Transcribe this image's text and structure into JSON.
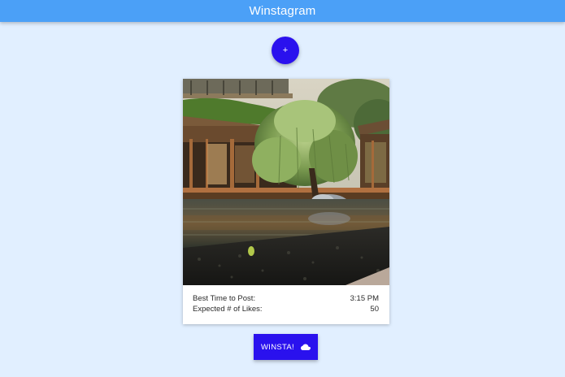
{
  "app": {
    "title": "Winstagram"
  },
  "add_button": {
    "label": "+"
  },
  "card": {
    "image_icon": "photo-of-pond-house-with-tree",
    "best_time_label": "Best Time to Post:",
    "best_time_value": "3:15 PM",
    "likes_label": "Expected # of Likes:",
    "likes_value": "50"
  },
  "action_button": {
    "label": "WINSTA!",
    "icon": "cloud-icon"
  },
  "colors": {
    "topbar": "#4ba0f7",
    "background": "#e1efff",
    "accent": "#2a11ee"
  }
}
